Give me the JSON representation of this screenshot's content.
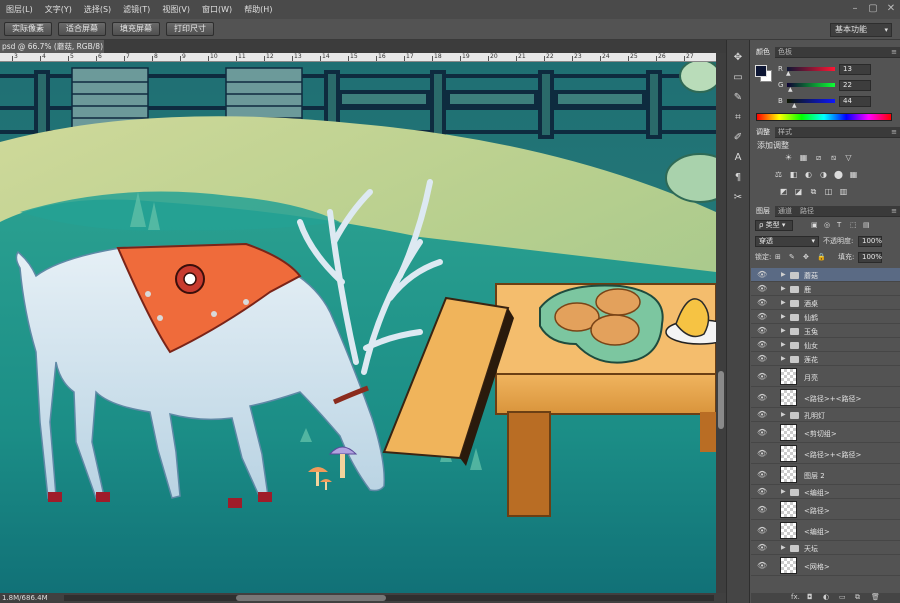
{
  "menubar": {
    "items": [
      "图层(L)",
      "文字(Y)",
      "选择(S)",
      "滤镜(T)",
      "视图(V)",
      "窗口(W)",
      "帮助(H)"
    ],
    "window_controls": [
      "–",
      "▢",
      "✕"
    ]
  },
  "options_bar": {
    "buttons": [
      "实际像素",
      "适合屏幕",
      "填充屏幕",
      "打印尺寸"
    ],
    "workspace": "基本功能"
  },
  "document_tab": {
    "title": "psd @ 66.7% (蘑菇, RGB/8) *",
    "close": "×"
  },
  "ruler": {
    "labels": [
      "3",
      "4",
      "5",
      "6",
      "7",
      "8",
      "9",
      "10",
      "11",
      "12",
      "13",
      "14",
      "15",
      "16",
      "17",
      "18",
      "19",
      "20",
      "21",
      "22",
      "23",
      "24",
      "25",
      "26",
      "27"
    ]
  },
  "status_bar": {
    "doc_size": "1.8M/686.4M"
  },
  "tools": {
    "icons": [
      "move-tool-icon",
      "marquee-tool-icon",
      "lasso-tool-icon",
      "crop-tool-icon",
      "eyedropper-tool-icon",
      "text-tool-icon",
      "paragraph-tool-icon",
      "brush-tool-icon"
    ],
    "glyphs": [
      "✥",
      "▭",
      "✎",
      "⌗",
      "✐",
      "A",
      "¶",
      "✂"
    ]
  },
  "color_panel": {
    "tabs": [
      "颜色",
      "色板"
    ],
    "channels": [
      {
        "label": "R",
        "value": "13",
        "fraction": 0.051,
        "color": "#ff3c3c"
      },
      {
        "label": "G",
        "value": "22",
        "fraction": 0.086,
        "color": "#3cdc3c"
      },
      {
        "label": "B",
        "value": "44",
        "fraction": 0.173,
        "color": "#3c64ff"
      }
    ],
    "foreground": "#0d1634",
    "background": "#ffffff"
  },
  "adjust_panel": {
    "tabs": [
      "调整",
      "样式"
    ],
    "title": "添加调整",
    "row1": [
      "☀",
      "▦",
      "⧄",
      "⧅",
      "▽"
    ],
    "row2": [
      "⚖",
      "◧",
      "◐",
      "◑",
      "⬤",
      "▦"
    ],
    "row3": [
      "◩",
      "◪",
      "⧉",
      "◫",
      "▥"
    ]
  },
  "layers_panel": {
    "tabs": [
      "图层",
      "通道",
      "路径"
    ],
    "filter_label": "类型",
    "filter_icons": [
      "▣",
      "◎",
      "T",
      "⬚",
      "▤"
    ],
    "blend_mode": "穿透",
    "opacity_label": "不透明度:",
    "opacity": "100%",
    "lock_label": "锁定:",
    "lock_icons": [
      "⊞",
      "✎",
      "✥",
      "🔒"
    ],
    "fill_label": "填充:",
    "fill": "100%",
    "layers": [
      {
        "name": "蘑菇",
        "kind": "folder",
        "selected": true
      },
      {
        "name": "鹿",
        "kind": "folder"
      },
      {
        "name": "酒桌",
        "kind": "folder"
      },
      {
        "name": "仙鹤",
        "kind": "folder"
      },
      {
        "name": "玉兔",
        "kind": "folder"
      },
      {
        "name": "仙女",
        "kind": "folder"
      },
      {
        "name": "莲花",
        "kind": "folder"
      },
      {
        "name": "月亮",
        "kind": "layer"
      },
      {
        "name": "<路径>+<路径>",
        "kind": "layer"
      },
      {
        "name": "孔明灯",
        "kind": "folder"
      },
      {
        "name": "<剪切组>",
        "kind": "layer"
      },
      {
        "name": "<路径>+<路径>",
        "kind": "layer"
      },
      {
        "name": "图层 2",
        "kind": "layer"
      },
      {
        "name": "<编组>",
        "kind": "folder"
      },
      {
        "name": "<路径>",
        "kind": "layer"
      },
      {
        "name": "<编组>",
        "kind": "layer"
      },
      {
        "name": "天坛",
        "kind": "folder"
      },
      {
        "name": "<网格>",
        "kind": "layer"
      }
    ],
    "footer_icons": [
      "fx.",
      "◘",
      "◐",
      "▭",
      "⧉",
      "🗑"
    ]
  }
}
